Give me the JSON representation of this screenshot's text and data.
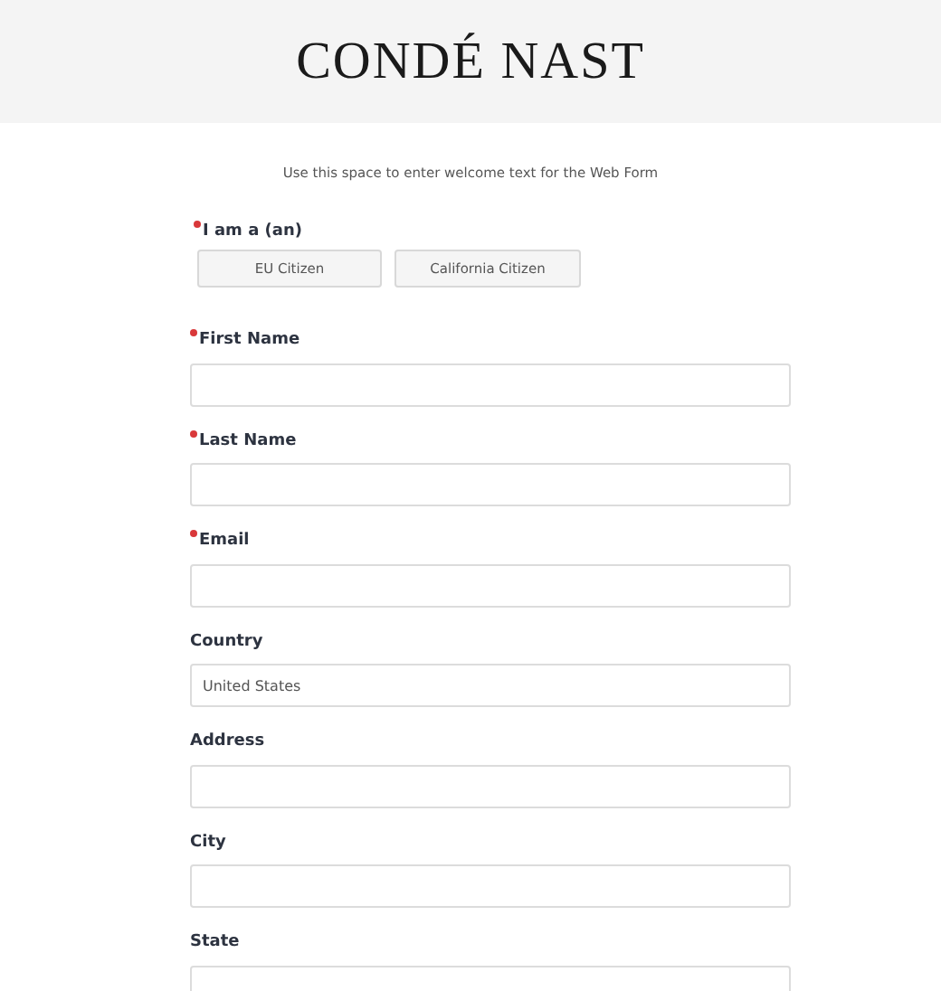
{
  "header": {
    "logo": "CONDÉ NAST"
  },
  "welcome": "Use this space to enter welcome text for the Web Form",
  "choice": {
    "label": "I am a (an)",
    "required": true,
    "options": [
      {
        "label": "EU Citizen",
        "selected": false
      },
      {
        "label": "California Citizen",
        "selected": false
      }
    ]
  },
  "fields": [
    {
      "label": "First Name",
      "required": true
    },
    {
      "label": "Last Name",
      "required": true
    },
    {
      "label": "Email",
      "required": true
    },
    {
      "label": "Country",
      "required": false,
      "value": "United States"
    },
    {
      "label": "Address",
      "required": false
    },
    {
      "label": "City",
      "required": false
    },
    {
      "label": "State",
      "required": false
    }
  ]
}
